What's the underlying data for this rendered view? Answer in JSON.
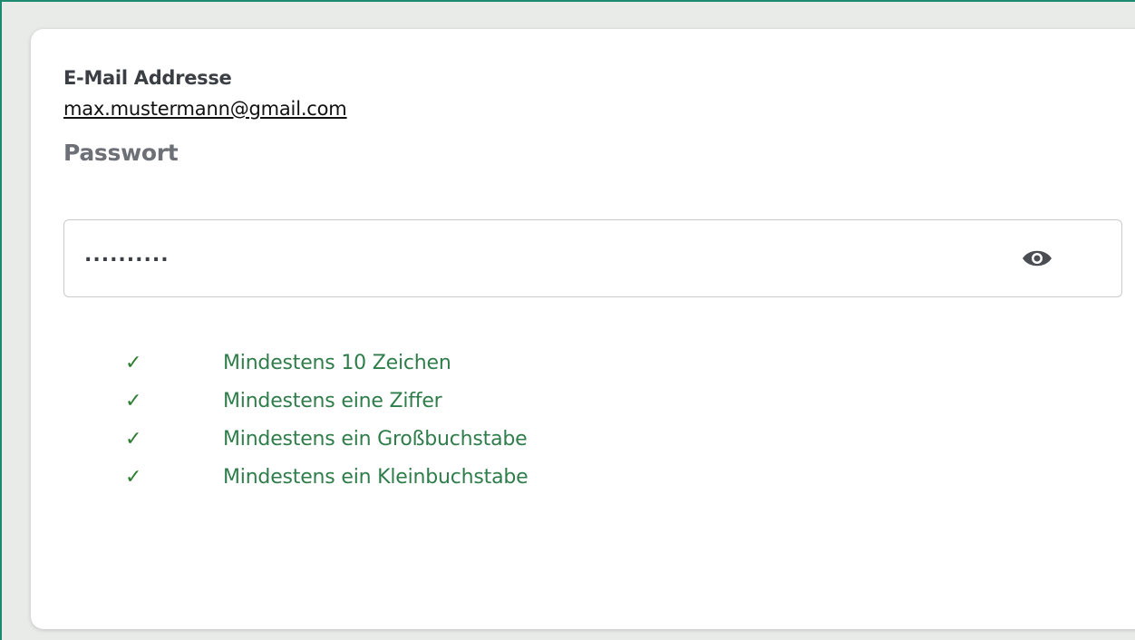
{
  "form": {
    "email_label": "E-Mail Addresse",
    "email_value": "max.mustermann@gmail.com",
    "password_label": "Passwort",
    "password_mask": "..........",
    "toggle_icon": "eye-icon"
  },
  "rules": [
    {
      "text": "Mindestens 10 Zeichen",
      "met": true
    },
    {
      "text": "Mindestens eine Ziffer",
      "met": true
    },
    {
      "text": "Mindestens ein Großbuchstabe",
      "met": true
    },
    {
      "text": "Mindestens ein Kleinbuchstabe",
      "met": true
    }
  ],
  "colors": {
    "frame_border": "#1e8a72",
    "rule_text": "#2f7d4a",
    "check": "#2e7d32"
  }
}
